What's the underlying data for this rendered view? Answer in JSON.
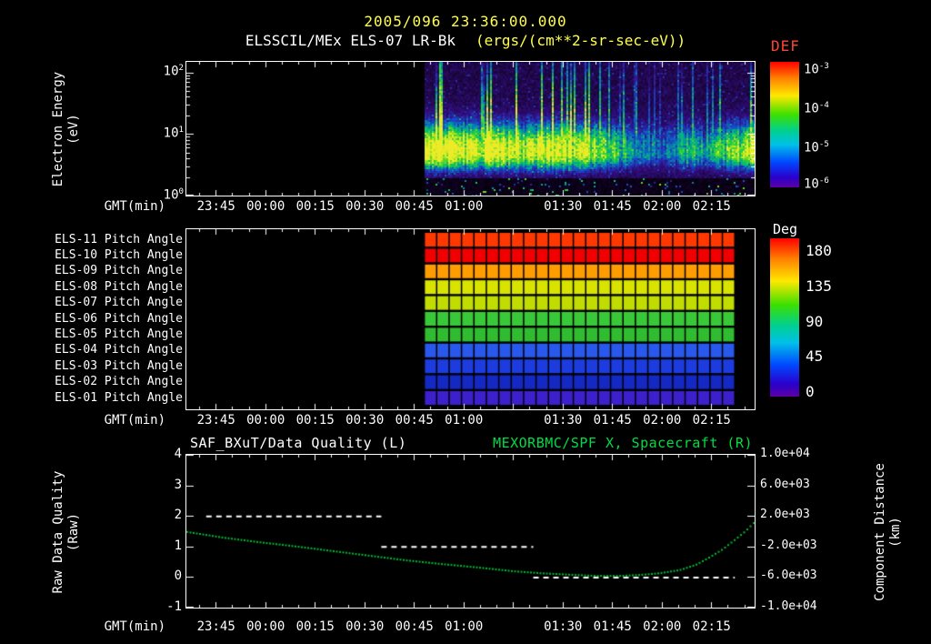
{
  "header": {
    "datetime": "2005/096 23:36:00.000",
    "instrument": "ELSSCIL/MEx ELS-07 LR-Bk",
    "units": "(ergs/(cm**2-sr-sec-eV))"
  },
  "x_axis": {
    "title": "GMT(min)",
    "start": "23:36",
    "end": "02:28",
    "tick_labels": [
      "23:45",
      "00:00",
      "00:15",
      "00:30",
      "00:45",
      "01:00",
      "01:30",
      "01:45",
      "02:00",
      "02:15"
    ]
  },
  "colors": {
    "background": "#000000",
    "title_yellow": "#ffff4d",
    "text_white": "#ffffff",
    "def_red": "#ff4433",
    "header_green": "#00dd44",
    "series_green": "#00bb33"
  },
  "chart_data": [
    {
      "type": "heatmap",
      "name": "electron-energy-spectrogram",
      "title": "ELSSCIL/MEx ELS-07 LR-Bk",
      "units_label": "(ergs/(cm**2-sr-sec-eV))",
      "ylabel": "Electron Energy",
      "ylabel_units": "(eV)",
      "y_scale": "log",
      "y_range_eV": [
        1,
        150
      ],
      "y_tick_labels": [
        "10^2",
        "10^1",
        "10^0"
      ],
      "colorbar": {
        "title": "DEF",
        "tick_labels": [
          "10^-3",
          "10^-4",
          "10^-5",
          "10^-6"
        ]
      },
      "data_start": "00:48",
      "data_end": "02:28",
      "peak_energy_eV": 5,
      "time_profile": {
        "times": [
          "00:48",
          "00:56",
          "01:04",
          "01:12",
          "01:20",
          "01:28",
          "01:36",
          "01:44",
          "01:52",
          "02:00",
          "02:08",
          "02:14",
          "02:22",
          "02:28"
        ],
        "relative_intensity": [
          0.9,
          1.0,
          0.85,
          0.95,
          0.8,
          0.85,
          0.75,
          0.6,
          0.35,
          0.25,
          0.5,
          0.35,
          0.7,
          0.9
        ]
      }
    },
    {
      "type": "heatmap",
      "name": "pitch-angle-panel",
      "colorbar": {
        "title": "Deg",
        "tick_labels": [
          "180",
          "135",
          "90",
          "45",
          "0"
        ],
        "range_deg": [
          0,
          180
        ]
      },
      "data_start": "00:48",
      "data_end": "02:22",
      "cells": 25,
      "rows": [
        {
          "label": "ELS-11 Pitch Angle",
          "approx_deg": 170,
          "color": "#ff3800"
        },
        {
          "label": "ELS-10 Pitch Angle",
          "approx_deg": 180,
          "color": "#f00000"
        },
        {
          "label": "ELS-09 Pitch Angle",
          "approx_deg": 150,
          "color": "#ff9c00"
        },
        {
          "label": "ELS-08 Pitch Angle",
          "approx_deg": 120,
          "color": "#d8e400"
        },
        {
          "label": "ELS-07 Pitch Angle",
          "approx_deg": 115,
          "color": "#c0dc00"
        },
        {
          "label": "ELS-06 Pitch Angle",
          "approx_deg": 90,
          "color": "#38c838"
        },
        {
          "label": "ELS-05 Pitch Angle",
          "approx_deg": 85,
          "color": "#30bc30"
        },
        {
          "label": "ELS-04 Pitch Angle",
          "approx_deg": 50,
          "color": "#2858ec"
        },
        {
          "label": "ELS-03 Pitch Angle",
          "approx_deg": 40,
          "color": "#1c3ce0"
        },
        {
          "label": "ELS-02 Pitch Angle",
          "approx_deg": 30,
          "color": "#1428c4"
        },
        {
          "label": "ELS-01 Pitch Angle",
          "approx_deg": 10,
          "color": "#3c20cc"
        }
      ]
    },
    {
      "type": "line",
      "name": "quality-and-distance",
      "left_title": "SAF_BXuT/Data Quality (L)",
      "right_title": "MEXORBMC/SPF X, Spacecraft (R)",
      "left_axis": {
        "label": "Raw Data Quality",
        "units": "(Raw)",
        "tick_labels": [
          "4",
          "3",
          "2",
          "1",
          "0",
          "-1"
        ],
        "range": [
          -1,
          4
        ]
      },
      "right_axis": {
        "label": "Component Distance",
        "units": "(km)",
        "tick_labels": [
          "1.0e+04",
          "6.0e+03",
          "2.0e+03",
          "-2.0e+03",
          "-6.0e+03",
          "-1.0e+04"
        ],
        "range": [
          -10000,
          10000
        ]
      },
      "series": [
        {
          "name": "SAF_BXuT/Data Quality",
          "axis": "left",
          "style": "dashed",
          "color": "#ffffff",
          "segments": [
            {
              "t0": "23:42",
              "t1": "00:35",
              "value": 2
            },
            {
              "t0": "00:35",
              "t1": "01:21",
              "value": 1
            },
            {
              "t0": "01:21",
              "t1": "02:22",
              "value": 0
            }
          ]
        },
        {
          "name": "MEXORBMC/SPF X Spacecraft",
          "axis": "right",
          "style": "dotted",
          "color": "#00bb33",
          "t": [
            "23:36",
            "23:47",
            "23:58",
            "00:09",
            "00:20",
            "00:31",
            "00:42",
            "00:53",
            "01:04",
            "01:15",
            "01:23",
            "01:32",
            "01:40",
            "01:47",
            "01:54",
            "01:59",
            "02:05",
            "02:10",
            "02:14",
            "02:18",
            "02:22",
            "02:25",
            "02:28"
          ],
          "km": [
            -100,
            -850,
            -1450,
            -2000,
            -2600,
            -3200,
            -3800,
            -4300,
            -4750,
            -5250,
            -5500,
            -5700,
            -5850,
            -5850,
            -5700,
            -5500,
            -5100,
            -4400,
            -3450,
            -2400,
            -1050,
            0,
            1300
          ]
        }
      ]
    }
  ]
}
